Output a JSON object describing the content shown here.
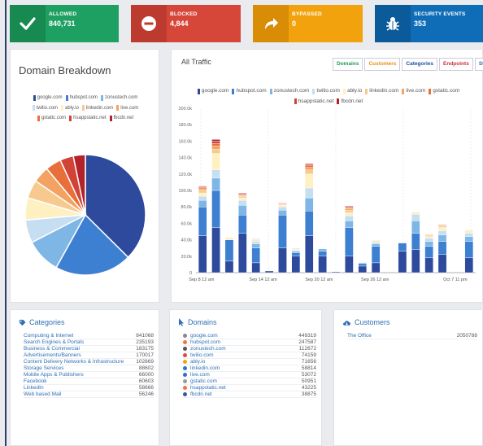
{
  "tiles": [
    {
      "title": "ALLOWED",
      "value": "840,731",
      "color": "#1ea062",
      "icon": "check-icon"
    },
    {
      "title": "BLOCKED",
      "value": "4,844",
      "color": "#d6473a",
      "icon": "minus-circle-icon"
    },
    {
      "title": "BYPASSED",
      "value": "0",
      "color": "#f2a20d",
      "icon": "share-arrow-icon"
    },
    {
      "title": "SECURITY EVENTS",
      "value": "353",
      "color": "#0f6db8",
      "icon": "bug-icon"
    }
  ],
  "domain_breakdown": {
    "title": "Domain Breakdown",
    "legend": [
      "google.com",
      "hubspot.com",
      "zonustech.com",
      "twilio.com",
      "ably.io",
      "linkedin.com",
      "live.com",
      "gstatic.com",
      "hsappstatic.net",
      "fbcdn.net"
    ]
  },
  "all_traffic": {
    "title": "All Traffic",
    "tabs": [
      "Domains",
      "Customers",
      "Categories",
      "Endpoints",
      "States"
    ],
    "legend": [
      "google.com",
      "hubspot.com",
      "zonustech.com",
      "twilio.com",
      "ably.io",
      "linkedin.com",
      "live.com",
      "gstatic.com",
      "hsappstatic.net",
      "fbcdn.net"
    ]
  },
  "categories": {
    "title": "Categories",
    "rows": [
      {
        "name": "Computing & Internet",
        "count": "841068"
      },
      {
        "name": "Search Engines & Portals",
        "count": "235193"
      },
      {
        "name": "Business & Commercial",
        "count": "183175"
      },
      {
        "name": "Advertisements/Banners",
        "count": "170017"
      },
      {
        "name": "Content Delivery Networks & Infrastructure",
        "count": "102869"
      },
      {
        "name": "Storage Services",
        "count": "88602"
      },
      {
        "name": "Mobile Apps & Publishers",
        "count": "66000"
      },
      {
        "name": "Facebook",
        "count": "60603"
      },
      {
        "name": "LinkedIn",
        "count": "58666"
      },
      {
        "name": "Web based Mail",
        "count": "56246"
      }
    ]
  },
  "domains": {
    "title": "Domains",
    "rows": [
      {
        "name": "google.com",
        "count": "449319",
        "icon": "google-icon",
        "color": "#888"
      },
      {
        "name": "hubspot.com",
        "count": "247587",
        "icon": "hubspot-icon",
        "color": "#f07540"
      },
      {
        "name": "zonustech.com",
        "count": "112672",
        "icon": "zonustech-icon",
        "color": "#555"
      },
      {
        "name": "twilio.com",
        "count": "74159",
        "icon": "twilio-icon",
        "color": "#e0444a"
      },
      {
        "name": "ably.io",
        "count": "71656",
        "icon": "ably-icon",
        "color": "#f2a20d"
      },
      {
        "name": "linkedin.com",
        "count": "58814",
        "icon": "linkedin-icon",
        "color": "#2a7ab8"
      },
      {
        "name": "live.com",
        "count": "53072",
        "icon": "live-icon",
        "color": "#2a6fd6"
      },
      {
        "name": "gstatic.com",
        "count": "50951",
        "icon": "gstatic-icon",
        "color": "#9a9a9a"
      },
      {
        "name": "hsappstatic.net",
        "count": "43225",
        "icon": "hsappstatic-icon",
        "color": "#f07540"
      },
      {
        "name": "fbcdn.net",
        "count": "38875",
        "icon": "fbcdn-icon",
        "color": "#3b5998"
      }
    ]
  },
  "customers": {
    "title": "Customers",
    "rows": [
      {
        "name": "The Office",
        "count": "2050788"
      }
    ]
  },
  "colors": [
    "#2e4a9c",
    "#3d7fd1",
    "#7eb7e6",
    "#c6def2",
    "#fff0c2",
    "#f7c98e",
    "#f4a262",
    "#e86f3a",
    "#d24237",
    "#b3222a"
  ],
  "chart_data": [
    {
      "type": "pie",
      "labels": [
        "google.com",
        "hubspot.com",
        "zonustech.com",
        "twilio.com",
        "ably.io",
        "linkedin.com",
        "live.com",
        "gstatic.com",
        "hsappstatic.net",
        "fbcdn.net"
      ],
      "values": [
        449319,
        247587,
        112672,
        74159,
        71656,
        58814,
        53072,
        50951,
        43225,
        38875
      ]
    },
    {
      "type": "bar",
      "stacked": true,
      "ylim": [
        0,
        200000
      ],
      "yticks": [
        "0",
        "20.0k",
        "40.0k",
        "60.0k",
        "80.0k",
        "100.0k",
        "120.0k",
        "140.0k",
        "160.0k",
        "180.0k",
        "200.0k"
      ],
      "xticks": [
        "Sep 8 12 am",
        "Sep 14 12 am",
        "Sep 20 12 am",
        "Sep 26 12 am",
        "Oct 7 11 pm"
      ],
      "series_names": [
        "google.com",
        "hubspot.com",
        "zonustech.com",
        "twilio.com",
        "ably.io",
        "linkedin.com",
        "live.com",
        "gstatic.com",
        "hsappstatic.net",
        "fbcdn.net"
      ],
      "stacks": [
        [
          45000,
          35000,
          8000,
          5000,
          4000,
          3000,
          2000,
          1500,
          1000,
          800
        ],
        [
          55000,
          45000,
          15000,
          10000,
          20000,
          5000,
          4000,
          3000,
          3000,
          2000
        ],
        [
          14000,
          26000,
          0,
          0,
          3000,
          0,
          0,
          0,
          0,
          0
        ],
        [
          48000,
          22000,
          12000,
          6000,
          3000,
          2000,
          1000,
          1000,
          1000,
          800
        ],
        [
          12000,
          18000,
          5000,
          3000,
          1000,
          1000,
          500,
          500,
          300,
          200
        ],
        [
          2000,
          0,
          0,
          0,
          0,
          0,
          0,
          0,
          0,
          0
        ],
        [
          30000,
          40000,
          6000,
          4000,
          2000,
          1000,
          1000,
          500,
          500,
          300
        ],
        [
          20000,
          4000,
          2000,
          1500,
          1000,
          800,
          500,
          300,
          200,
          200
        ],
        [
          45000,
          30000,
          16000,
          12000,
          17000,
          5000,
          3000,
          2000,
          1500,
          1000
        ],
        [
          20000,
          6000,
          3000,
          0,
          0,
          0,
          0,
          0,
          0,
          0
        ],
        [
          1000,
          0,
          0,
          0,
          0,
          0,
          0,
          0,
          0,
          0
        ],
        [
          20000,
          35000,
          8000,
          6000,
          4000,
          3000,
          2000,
          1000,
          1000,
          800
        ],
        [
          8000,
          3000,
          1000,
          500,
          0,
          0,
          0,
          0,
          0,
          0
        ],
        [
          12000,
          20000,
          3000,
          2000,
          1000,
          1000,
          500,
          300,
          200,
          0
        ],
        [
          0,
          0,
          0,
          0,
          0,
          0,
          0,
          0,
          0,
          0
        ],
        [
          26000,
          10000,
          0,
          0,
          0,
          0,
          0,
          0,
          0,
          0
        ],
        [
          28000,
          20000,
          15000,
          8000,
          3000,
          0,
          0,
          0,
          0,
          0
        ],
        [
          18000,
          14000,
          6000,
          4000,
          2000,
          1000,
          1000,
          500,
          300,
          200
        ],
        [
          22000,
          16000,
          8000,
          5000,
          4000,
          2000,
          1000,
          500,
          300,
          200
        ],
        [
          0,
          0,
          0,
          0,
          0,
          0,
          0,
          0,
          0,
          0
        ],
        [
          18000,
          20000,
          6000,
          4000,
          2000,
          1000,
          500,
          300,
          200,
          0
        ]
      ]
    }
  ]
}
